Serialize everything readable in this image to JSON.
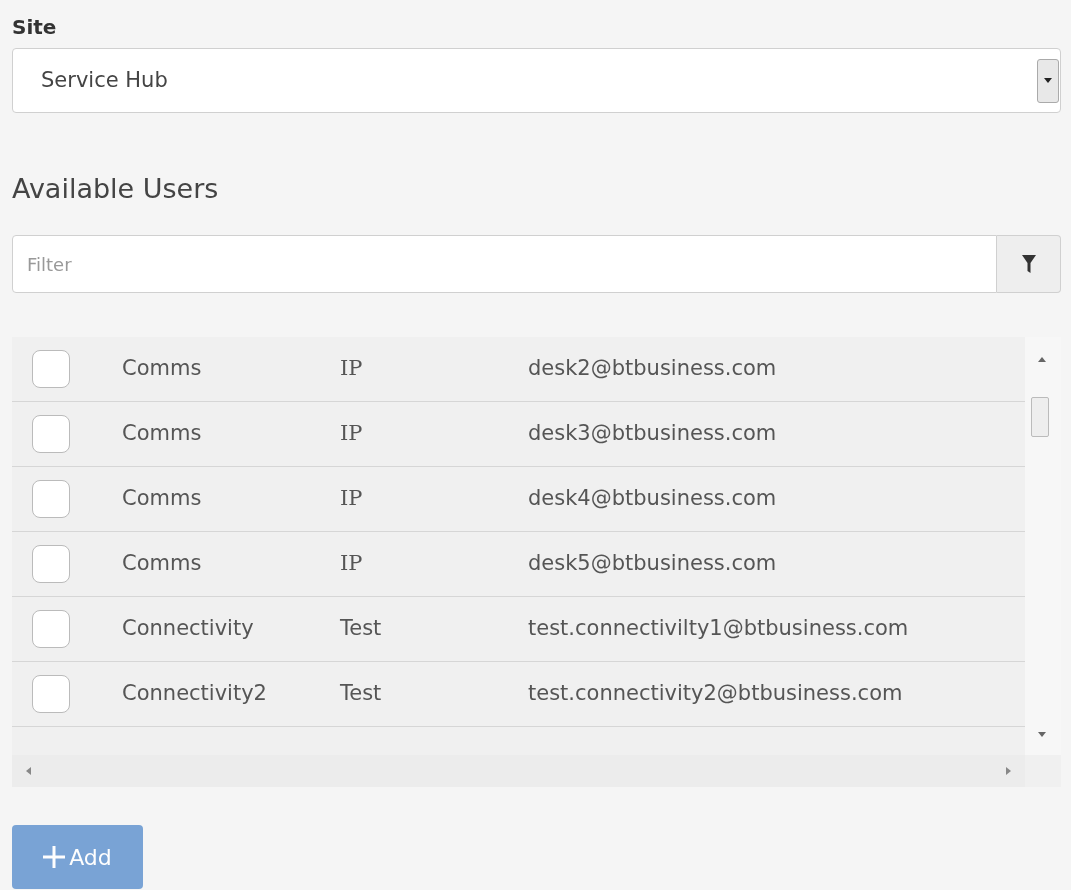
{
  "site": {
    "label": "Site",
    "value": "Service Hub"
  },
  "heading": "Available Users",
  "filter": {
    "placeholder": "Filter"
  },
  "users": [
    {
      "checked": false,
      "name": "Comms",
      "type": "IP",
      "email": "desk2@btbusiness.com"
    },
    {
      "checked": false,
      "name": "Comms",
      "type": "IP",
      "email": "desk3@btbusiness.com"
    },
    {
      "checked": false,
      "name": "Comms",
      "type": "IP",
      "email": "desk4@btbusiness.com"
    },
    {
      "checked": false,
      "name": "Comms",
      "type": "IP",
      "email": "desk5@btbusiness.com"
    },
    {
      "checked": false,
      "name": "Connectivity",
      "type": "Test",
      "email": "test.connectivilty1@btbusiness.com"
    },
    {
      "checked": false,
      "name": "Connectivity2",
      "type": "Test",
      "email": "test.connectivity2@btbusiness.com"
    }
  ],
  "add_button": {
    "label": "Add",
    "disabled": true
  }
}
